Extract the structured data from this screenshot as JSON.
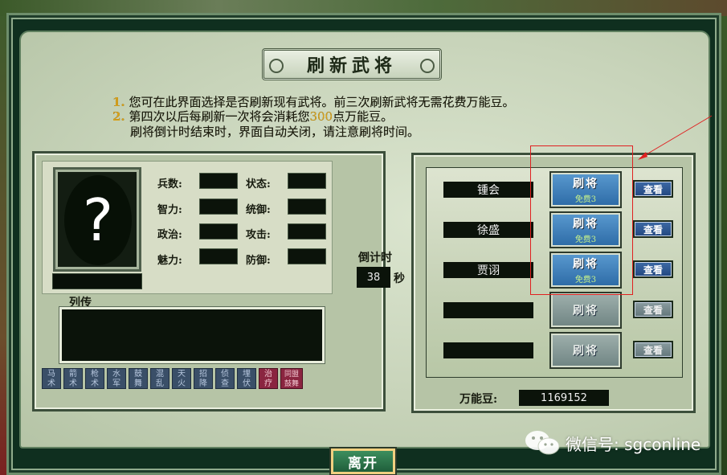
{
  "window": {
    "title": "刷新武将"
  },
  "instructions": {
    "line1_num": "1.",
    "line1_text": "您可在此界面选择是否刷新现有武将。前三次刷新武将无需花费万能豆。",
    "line2_num": "2.",
    "line2_a": "第四次以后每刷新一次将会消耗您",
    "line2_hl": "300",
    "line2_b": "点万能豆。",
    "line3_text": "刷将倒计时结束时，界面自动关闭，请注意刷将时间。"
  },
  "general_info": {
    "portrait_placeholder": "?",
    "stats": {
      "soldiers": "兵数:",
      "status": "状态:",
      "intelligence": "智力:",
      "command": "统御:",
      "politics": "政治:",
      "attack": "攻击:",
      "charisma": "魅力:",
      "defense": "防御:"
    },
    "bio_label": "列传"
  },
  "skills": [
    {
      "top": "马",
      "bottom": "术"
    },
    {
      "top": "箭",
      "bottom": "术"
    },
    {
      "top": "枪",
      "bottom": "术"
    },
    {
      "top": "水",
      "bottom": "军"
    },
    {
      "top": "鼓",
      "bottom": "舞"
    },
    {
      "top": "混",
      "bottom": "乱"
    },
    {
      "top": "天",
      "bottom": "火"
    },
    {
      "top": "招",
      "bottom": "降"
    },
    {
      "top": "侦",
      "bottom": "查"
    },
    {
      "top": "埋",
      "bottom": "伏"
    },
    {
      "top": "治",
      "bottom": "疗"
    },
    {
      "top": "同盟",
      "bottom": "鼓舞"
    }
  ],
  "countdown": {
    "label": "倒计时",
    "value": "38",
    "unit": "秒"
  },
  "refresh_list": [
    {
      "name": "锺会",
      "button_label": "刷将",
      "free_label": "免费3",
      "view_label": "查看",
      "enabled": true
    },
    {
      "name": "徐盛",
      "button_label": "刷将",
      "free_label": "免费3",
      "view_label": "查看",
      "enabled": true
    },
    {
      "name": "贾诩",
      "button_label": "刷将",
      "free_label": "免费3",
      "view_label": "查看",
      "enabled": true
    },
    {
      "name": "",
      "button_label": "刷将",
      "free_label": "",
      "view_label": "查看",
      "enabled": false
    },
    {
      "name": "",
      "button_label": "刷将",
      "free_label": "",
      "view_label": "查看",
      "enabled": false
    }
  ],
  "coins": {
    "label": "万能豆:",
    "value": "1169152"
  },
  "footer": {
    "leave_label": "离开"
  },
  "watermark": {
    "text": "微信号: sgconline"
  },
  "colors": {
    "panel_bg": "#c8d4ba",
    "highlight_box": "#e02020",
    "active_button": "#3d7fbf",
    "free_text": "#c8f28a",
    "instruction_number": "#d8a21c"
  }
}
